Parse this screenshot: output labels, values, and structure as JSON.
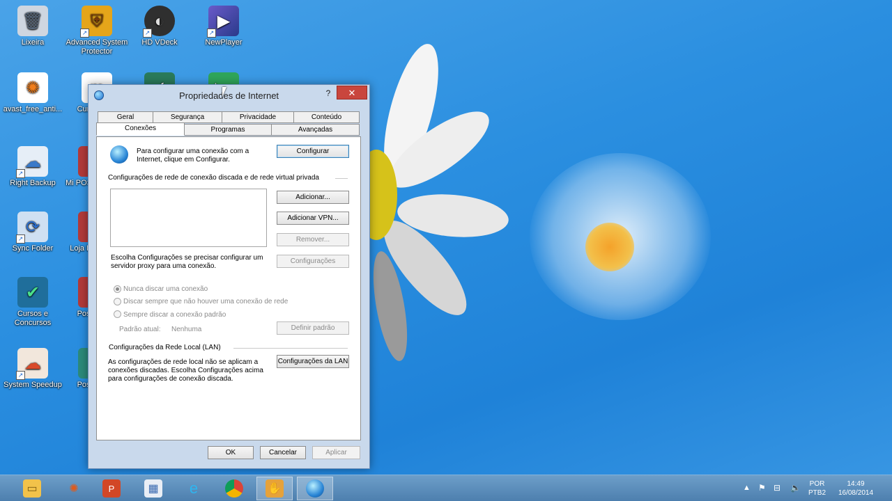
{
  "desktop": {
    "icons": [
      {
        "label": "Lixeira",
        "icon": "recycle-bin-icon",
        "color": "#d8dce4"
      },
      {
        "label": "Advanced System Protector",
        "icon": "shield-icon",
        "color": "#e5a51a"
      },
      {
        "label": "HD VDeck",
        "icon": "hdvdeck-icon",
        "color": "#333333"
      },
      {
        "label": "NewPlayer",
        "icon": "newplayer-icon",
        "color": "#3b4a9a"
      },
      {
        "label": "avast_free_anti...",
        "icon": "avast-icon",
        "color": "#f07d1a"
      },
      {
        "label": "Curso Easy",
        "icon": "curso-icon",
        "color": "#d8374a"
      },
      {
        "label": "Right Backup",
        "icon": "cloud-backup-icon",
        "color": "#e6eef7"
      },
      {
        "label": "Mi POS",
        "icon": "pos-icon",
        "color": "#b23a3a"
      },
      {
        "label": "Sync Folder",
        "icon": "sync-folder-icon",
        "color": "#cfe0f2"
      },
      {
        "label": "Loja D",
        "icon": "loja-icon",
        "color": "#b23a3a"
      },
      {
        "label": "Cursos e Concursos",
        "icon": "checkmark-icon",
        "color": "#1f9b6e"
      },
      {
        "label": "Posi",
        "icon": "posi-icon",
        "color": "#b23a3a"
      },
      {
        "label": "System Speedup",
        "icon": "speedup-icon",
        "color": "#d94a2a"
      },
      {
        "label": "Posi",
        "icon": "posi-icon",
        "color": "#2c8a7a"
      }
    ]
  },
  "dialog": {
    "title": "Propriedades de Internet",
    "help": "?",
    "close": "✕",
    "tabs_row1": [
      "Geral",
      "Segurança",
      "Privacidade",
      "Conteúdo"
    ],
    "tabs_row2": [
      "Conexões",
      "Programas",
      "Avançadas"
    ],
    "active_tab": "Conexões",
    "setup_text_line1": "Para configurar uma conexão com a",
    "setup_text_line2": "Internet, clique em Configurar.",
    "configure_button": "Configurar",
    "dialup_section": "Configurações de rede de conexão discada e de rede virtual privada",
    "add_button": "Adicionar...",
    "add_vpn_button": "Adicionar VPN...",
    "remove_button": "Remover...",
    "proxy_text_line1": "Escolha Configurações se precisar configurar um",
    "proxy_text_line2": "servidor proxy para uma conexão.",
    "settings_button": "Configurações",
    "radio_never": "Nunca discar uma conexão",
    "radio_when_none": "Discar sempre que não houver uma conexão de rede",
    "radio_always": "Sempre discar a conexão padrão",
    "current_default_label": "Padrão atual:",
    "current_default_value": "Nenhuma",
    "set_default_button": "Definir padrão",
    "lan_section": "Configurações da Rede Local (LAN)",
    "lan_text_line1": "As configurações de rede local não se aplicam a",
    "lan_text_line2": "conexões discadas. Escolha Configurações acima",
    "lan_text_line3": "para configurações de conexão discada.",
    "lan_button": "Configurações da LAN",
    "ok_button": "OK",
    "cancel_button": "Cancelar",
    "apply_button": "Aplicar"
  },
  "taskbar": {
    "items": [
      "file-explorer-icon",
      "avast-icon",
      "powerpoint-icon",
      "paint-icon",
      "internet-explorer-icon",
      "chrome-icon",
      "app-icon",
      "internet-options-icon"
    ],
    "language": "POR",
    "layout": "PTB2",
    "time": "14:49",
    "date": "16/08/2014"
  }
}
